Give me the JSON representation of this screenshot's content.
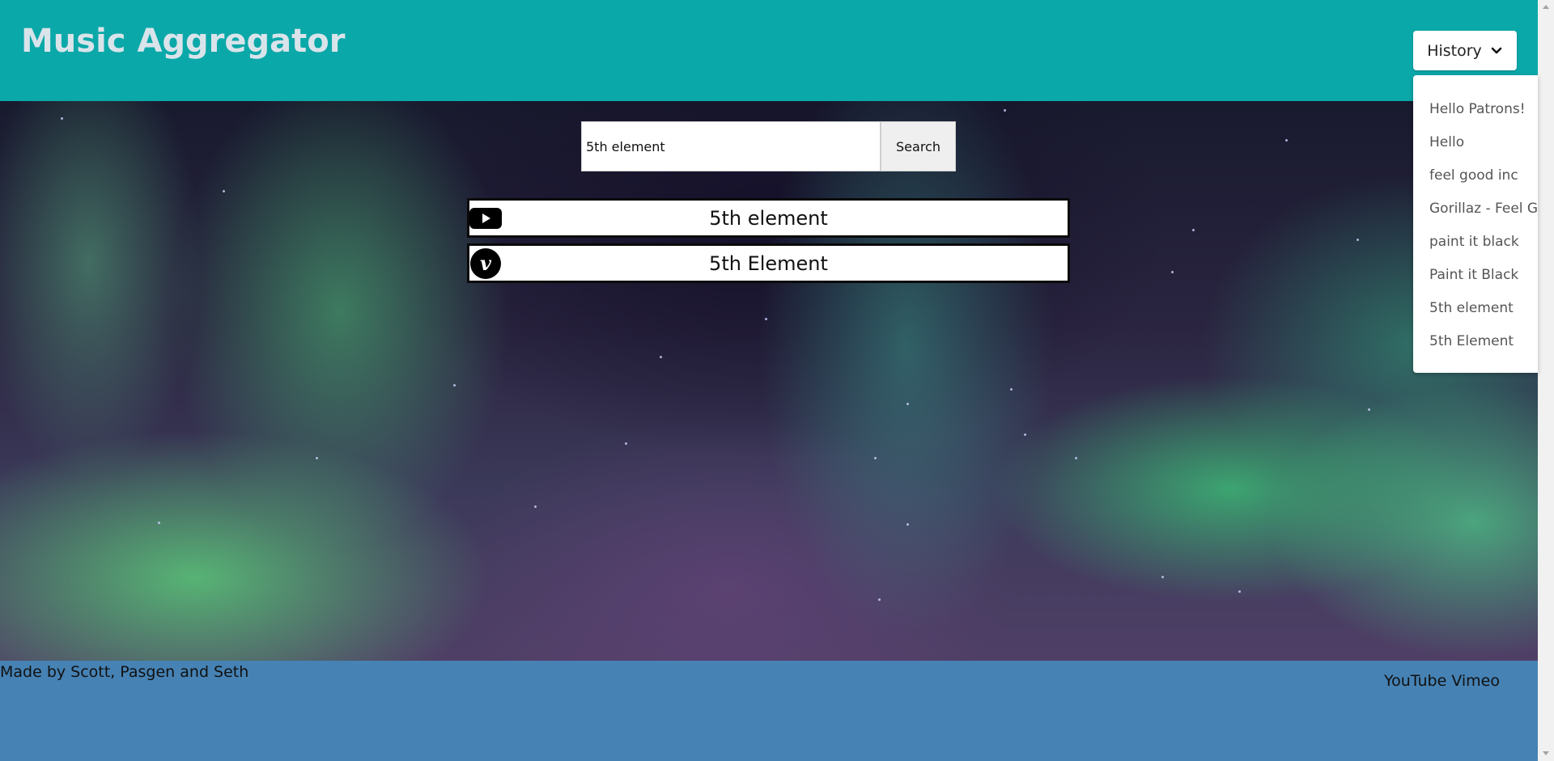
{
  "header": {
    "title": "Music Aggregator",
    "history_label": "History"
  },
  "history": {
    "items": [
      "Hello Patrons!",
      "Hello",
      "feel good inc",
      "Gorillaz - Feel Good Inc.",
      "paint it black",
      "Paint it Black",
      "5th element",
      "5th Element"
    ]
  },
  "search": {
    "value": "5th element",
    "button_label": "Search"
  },
  "results": [
    {
      "source": "youtube-icon",
      "title": "5th element"
    },
    {
      "source": "vimeo-icon",
      "title": "5th Element"
    }
  ],
  "footer": {
    "credit": "Made by Scott, Pasgen and Seth",
    "link_youtube": "YouTube",
    "link_vimeo": "Vimeo"
  },
  "colors": {
    "header_bg": "#0ba8a9",
    "footer_bg": "#4682b4",
    "title_color": "#d9e4ea"
  }
}
